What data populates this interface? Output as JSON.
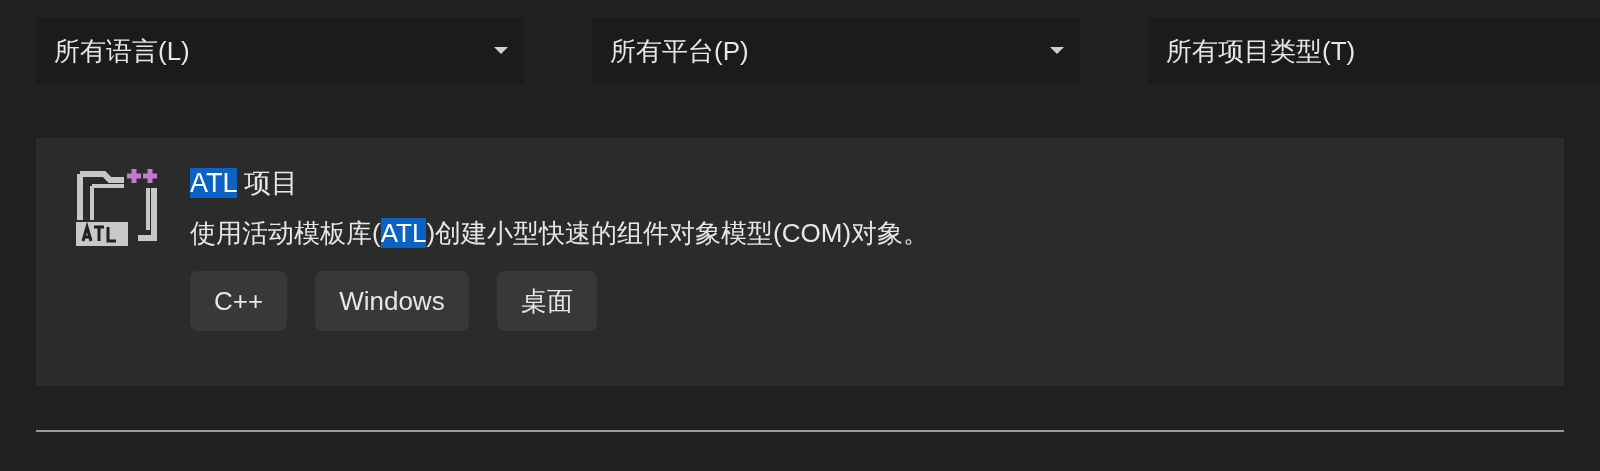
{
  "filters": [
    {
      "label": "所有语言(L)",
      "caret": true
    },
    {
      "label": "所有平台(P)",
      "caret": true
    },
    {
      "label": "所有项目类型(T)",
      "caret": false
    }
  ],
  "templates": [
    {
      "title": [
        {
          "text": "ATL",
          "highlighted": true
        },
        {
          "text": " 项目",
          "highlighted": false
        }
      ],
      "description": [
        {
          "text": "使用活动模板库(",
          "highlighted": false
        },
        {
          "text": "ATL",
          "highlighted": true
        },
        {
          "text": ")创建小型快速的组件对象模型(COM)对象。",
          "highlighted": false
        }
      ],
      "tags": [
        "C++",
        "Windows",
        "桌面"
      ]
    }
  ]
}
